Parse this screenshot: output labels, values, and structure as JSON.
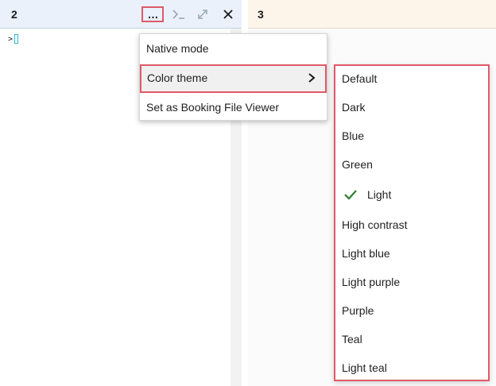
{
  "pane2": {
    "title": "2",
    "prompt": ">",
    "buttons": {
      "more": "…",
      "console_icon": "console-icon",
      "expand_icon": "expand-icon",
      "close_icon": "close-icon"
    }
  },
  "pane3": {
    "title": "3"
  },
  "menu": {
    "items": [
      {
        "label": "Native mode"
      },
      {
        "label": "Color theme",
        "has_submenu": true,
        "icon": "chevron-right-icon"
      },
      {
        "label": "Set as Booking File Viewer"
      }
    ]
  },
  "submenu": {
    "items": [
      {
        "label": "Default"
      },
      {
        "label": "Dark"
      },
      {
        "label": "Blue"
      },
      {
        "label": "Green"
      },
      {
        "label": "Light",
        "checked": true,
        "icon": "check-icon"
      },
      {
        "label": "High contrast"
      },
      {
        "label": "Light blue"
      },
      {
        "label": "Light purple"
      },
      {
        "label": "Purple"
      },
      {
        "label": "Teal"
      },
      {
        "label": "Light teal"
      }
    ]
  },
  "colors": {
    "highlight": "#e05a68",
    "pane2_header": "#eaf1fb",
    "pane3_header": "#fdf4ea",
    "check": "#2e7d32"
  }
}
